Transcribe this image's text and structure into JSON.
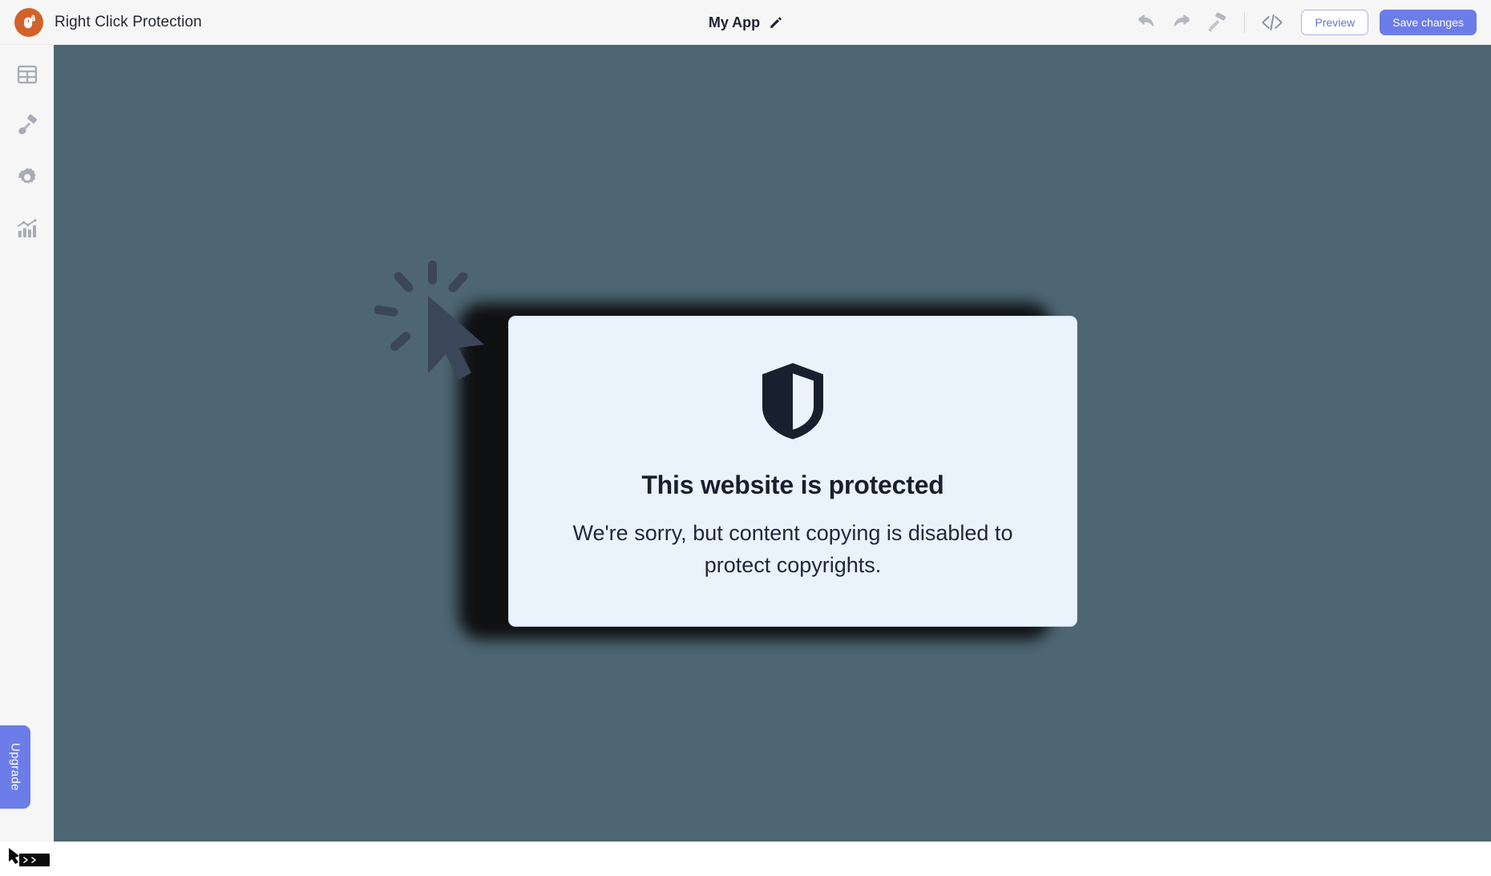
{
  "brand": {
    "title": "Right Click Protection",
    "logo_icon": "mouse-lock-icon",
    "logo_color": "#d3622a"
  },
  "header": {
    "app_name": "My App",
    "edit_icon": "pencil-icon",
    "actions": [
      {
        "icon": "undo-icon",
        "label": "Undo"
      },
      {
        "icon": "redo-icon",
        "label": "Redo"
      },
      {
        "icon": "paint-roller-icon",
        "label": "Theme"
      },
      {
        "icon": "code-icon",
        "label": "Custom code"
      }
    ],
    "preview_label": "Preview",
    "save_label": "Save changes",
    "primary_color": "#6c7ce8",
    "outline_color": "#aab2e8"
  },
  "sidebar": {
    "items": [
      {
        "icon": "table-layout-icon",
        "label": "Layout"
      },
      {
        "icon": "paint-brush-icon",
        "label": "Design"
      },
      {
        "icon": "gear-icon",
        "label": "Settings"
      },
      {
        "icon": "analytics-chart-icon",
        "label": "Analytics"
      }
    ],
    "upgrade_label": "Upgrade",
    "help_icon": "chat-widget-icon"
  },
  "canvas": {
    "background_color": "#4d6672",
    "cursor_icon": "click-cursor-icon"
  },
  "card": {
    "shield_icon": "shield-half-icon",
    "heading": "This website is protected",
    "body": "We're sorry, but content copying is disabled to protect copyrights.",
    "background_color": "#eaf2fc",
    "border_color": "#cfe0f2",
    "text_color": "#18202f"
  }
}
